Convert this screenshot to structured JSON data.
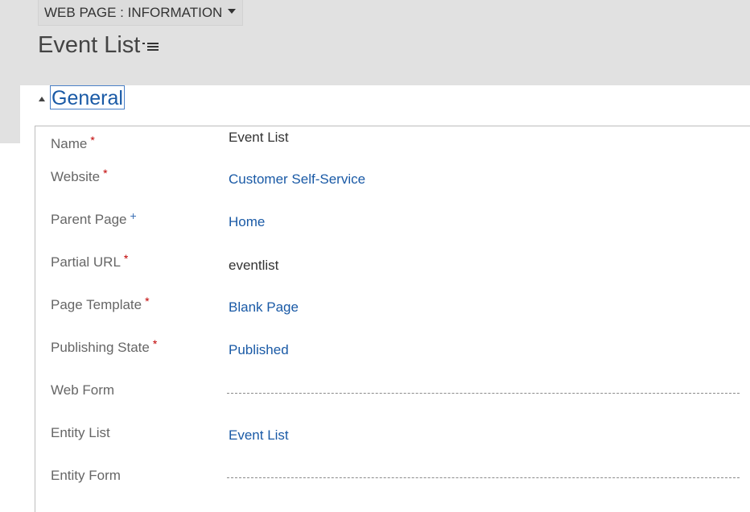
{
  "header": {
    "entity_label": "WEB PAGE : INFORMATION",
    "record_title": "Event List"
  },
  "section": {
    "title": "General"
  },
  "fields": [
    {
      "label": "Name",
      "required": "*",
      "value": "Event List"
    },
    {
      "label": "Website",
      "required": "*",
      "value": "Customer Self-Service"
    },
    {
      "label": "Parent Page",
      "recommended": "+",
      "value": "Home"
    },
    {
      "label": "Partial URL",
      "required": "*",
      "value": "eventlist"
    },
    {
      "label": "Page Template",
      "required": "*",
      "value": "Blank Page"
    },
    {
      "label": "Publishing State",
      "required": "*",
      "value": "Published"
    },
    {
      "label": "Web Form",
      "value": ""
    },
    {
      "label": "Entity List",
      "value": "Event List"
    },
    {
      "label": "Entity Form",
      "value": ""
    }
  ],
  "colors": {
    "header_bg": "#e1e1e1",
    "link": "#1a5aa6",
    "required": "#c00000",
    "recommended": "#3a6fb5"
  }
}
